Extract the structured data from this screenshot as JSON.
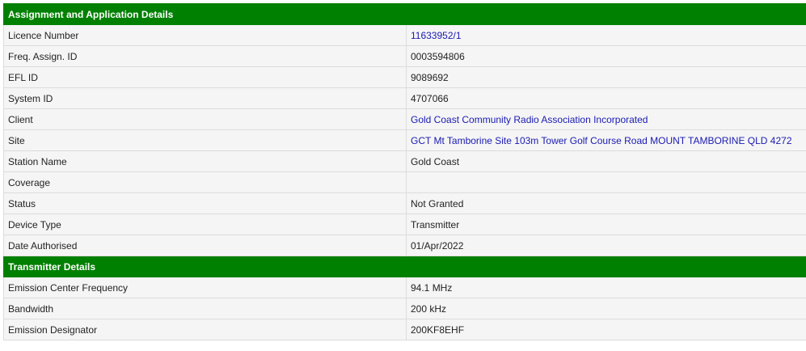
{
  "sections": [
    {
      "title": "Assignment and Application Details",
      "rows": [
        {
          "label": "Licence Number",
          "value": "11633952/1",
          "link": true
        },
        {
          "label": "Freq. Assign. ID",
          "value": "0003594806",
          "link": false
        },
        {
          "label": "EFL ID",
          "value": "9089692",
          "link": false
        },
        {
          "label": "System ID",
          "value": "4707066",
          "link": false
        },
        {
          "label": "Client",
          "value": "Gold Coast Community Radio Association Incorporated",
          "link": true
        },
        {
          "label": "Site",
          "value": "GCT Mt Tamborine Site 103m Tower Golf Course Road MOUNT TAMBORINE QLD 4272",
          "link": true
        },
        {
          "label": "Station Name",
          "value": "Gold Coast",
          "link": false
        },
        {
          "label": "Coverage",
          "value": "",
          "link": false
        },
        {
          "label": "Status",
          "value": "Not Granted",
          "link": false
        },
        {
          "label": "Device Type",
          "value": "Transmitter",
          "link": false
        },
        {
          "label": "Date Authorised",
          "value": "01/Apr/2022",
          "link": false
        }
      ]
    },
    {
      "title": "Transmitter Details",
      "rows": [
        {
          "label": "Emission Center Frequency",
          "value": "94.1 MHz",
          "link": false
        },
        {
          "label": "Bandwidth",
          "value": "200 kHz",
          "link": false
        },
        {
          "label": "Emission Designator",
          "value": "200KF8EHF",
          "link": false
        }
      ]
    }
  ],
  "colors": {
    "section_header_bg": "#008000",
    "link": "#1a1ab3",
    "row_bg": "#f5f5f5"
  }
}
